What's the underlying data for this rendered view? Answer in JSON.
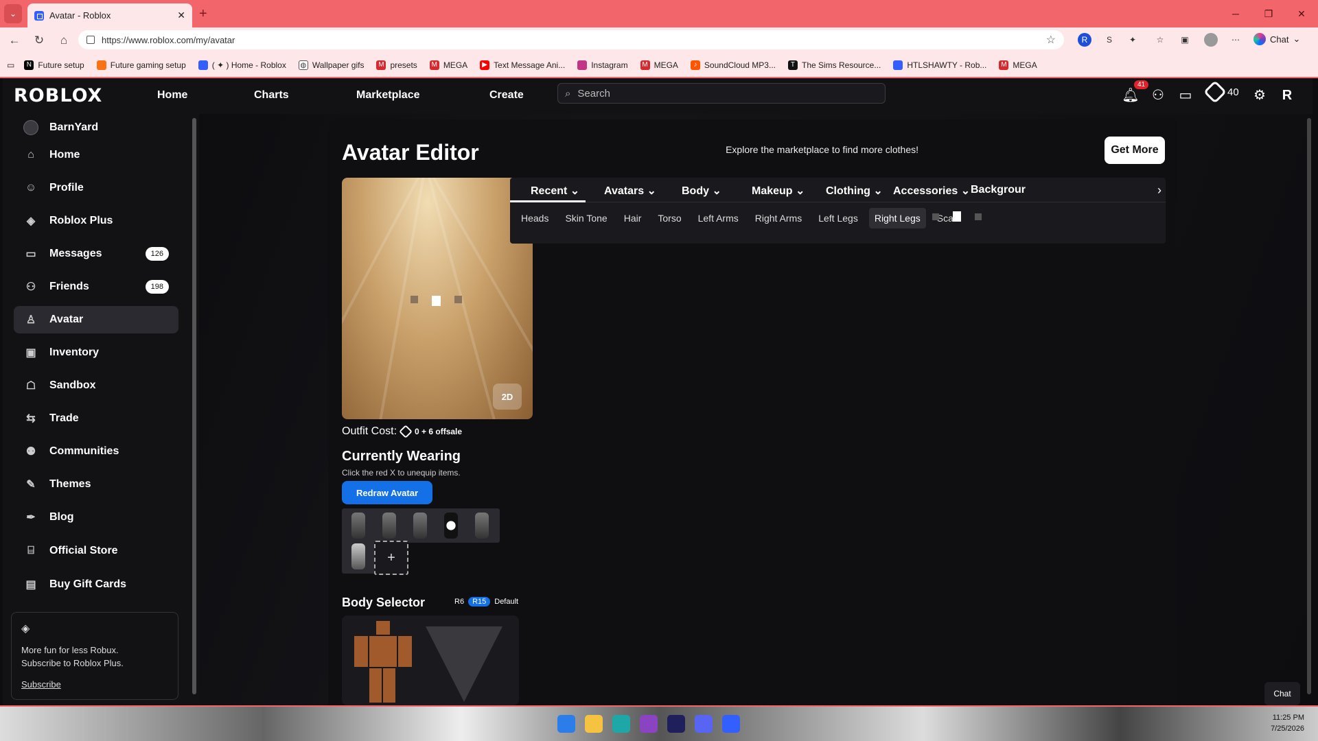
{
  "browser": {
    "tab_title": "Avatar - Roblox",
    "url": "https://www.roblox.com/my/avatar",
    "chat_label": "Chat",
    "bookmarks": [
      "Future setup",
      "Future gaming setup",
      "( ✦ ) Home - Roblox",
      "Wallpaper gifs",
      "presets",
      "MEGA",
      "Text Message Ani...",
      "Instagram",
      "MEGA",
      "SoundCloud MP3...",
      "The Sims Resource...",
      "HTLSHAWTY - Rob...",
      "MEGA"
    ]
  },
  "header": {
    "logo": "ROBLOX",
    "nav": [
      "Home",
      "Charts",
      "Marketplace",
      "Create"
    ],
    "search_placeholder": "Search",
    "notif_count": "41",
    "robux": "40"
  },
  "sidebar": {
    "username": "BarnYard",
    "items": [
      "Home",
      "Profile",
      "Roblox Plus",
      "Messages",
      "Friends",
      "Avatar",
      "Inventory",
      "Sandbox",
      "Trade",
      "Communities",
      "Themes",
      "Blog",
      "Official Store",
      "Buy Gift Cards"
    ],
    "messages_count": "126",
    "friends_count": "198",
    "promo_line1": "More fun for less Robux.",
    "promo_line2": "Subscribe to Roblox Plus.",
    "promo_link": "Subscribe"
  },
  "editor": {
    "title": "Avatar Editor",
    "explore": "Explore the marketplace to find more clothes!",
    "get_more": "Get More",
    "view_toggle": "2D",
    "outfit_cost_label": "Outfit Cost:",
    "outfit_cost_value": "0 + 6 offsale",
    "currently_wearing": "Currently Wearing",
    "wearing_hint": "Click the red X to unequip items.",
    "redraw": "Redraw Avatar",
    "body_selector": "Body Selector",
    "body_opts": [
      "R6",
      "R15",
      "Default"
    ],
    "tabs": [
      "Recent",
      "Avatars",
      "Body",
      "Makeup",
      "Clothing",
      "Accessories",
      "Backgrour"
    ],
    "subtabs": [
      "Heads",
      "Skin Tone",
      "Hair",
      "Torso",
      "Left Arms",
      "Right Arms",
      "Left Legs",
      "Right Legs",
      "Scale"
    ],
    "active_subtab": "Right Legs"
  },
  "chat_pill": "Chat",
  "clock": {
    "time": "11:25 PM",
    "date": "7/25/2026"
  },
  "colors": {
    "browser_accent": "#f2656a",
    "primary_button": "#1470e6"
  }
}
